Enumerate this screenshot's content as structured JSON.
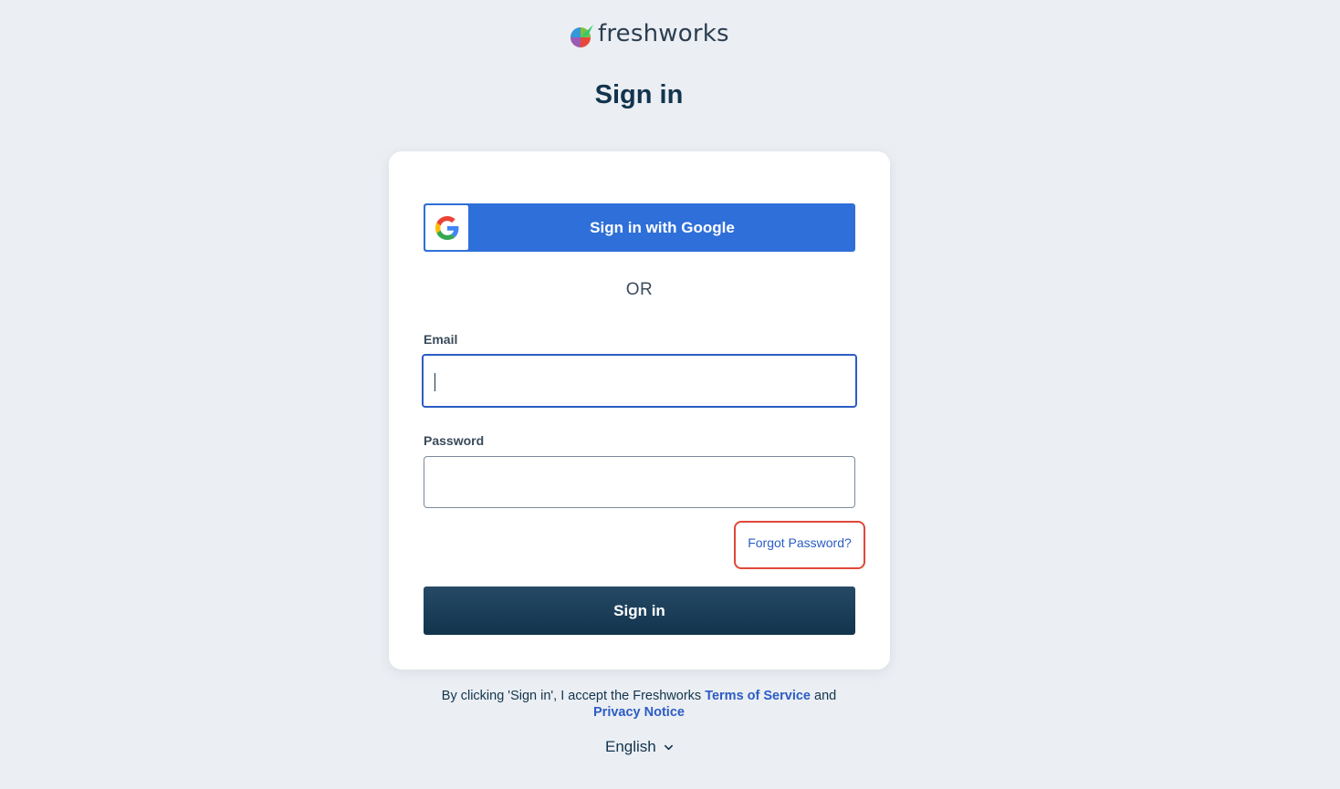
{
  "brand": {
    "name": "freshworks",
    "logo_icon": "freshworks-leaf-icon"
  },
  "page": {
    "title": "Sign in"
  },
  "google": {
    "label": "Sign in with Google",
    "icon": "google-icon"
  },
  "divider": {
    "text": "OR"
  },
  "email": {
    "label": "Email",
    "value": "",
    "placeholder": ""
  },
  "password": {
    "label": "Password",
    "value": "",
    "placeholder": ""
  },
  "forgot": {
    "label": "Forgot Password?"
  },
  "submit": {
    "label": "Sign in"
  },
  "legal": {
    "prefix": "By clicking 'Sign in', I accept the Freshworks",
    "terms_label": "Terms of Service",
    "conjunction": "and",
    "privacy_label": "Privacy Notice"
  },
  "language": {
    "selected": "English",
    "icon": "chevron-down-icon"
  },
  "colors": {
    "background": "#ebeef3",
    "primary_text": "#12344d",
    "google_blue": "#2f6fd9",
    "link_blue": "#2c5cc5",
    "highlight_red": "#e0483a",
    "signin_button": "#12344d"
  }
}
